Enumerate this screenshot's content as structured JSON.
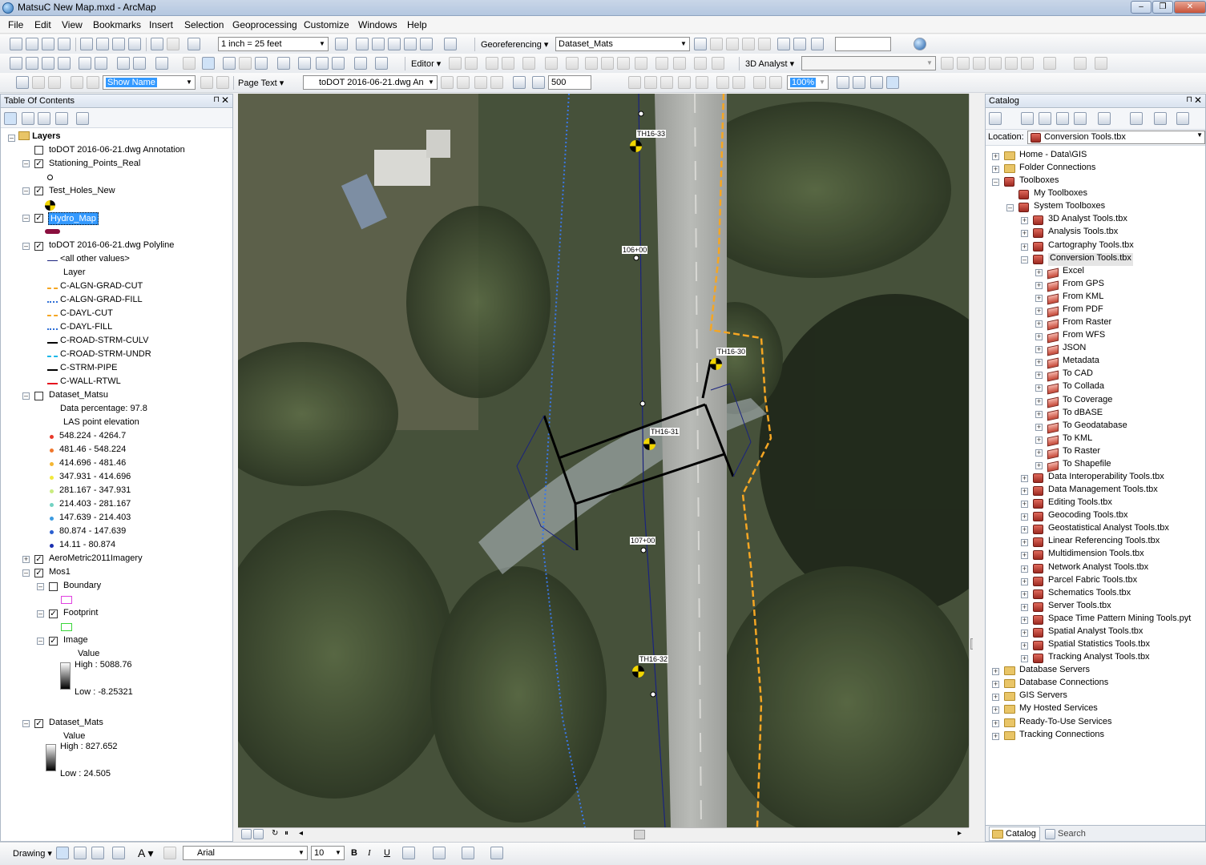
{
  "window": {
    "title": "MatsuC New Map.mxd - ArcMap",
    "controls": [
      "–",
      "❐",
      "✕"
    ]
  },
  "menu": [
    "File",
    "Edit",
    "View",
    "Bookmarks",
    "Insert",
    "Selection",
    "Geoprocessing",
    "Customize",
    "Windows",
    "Help"
  ],
  "toolbar1": {
    "scale": "1 inch = 25 feet",
    "georef_label": "Georeferencing ▾",
    "georef_layer": "Dataset_Mats",
    "empty_combo": ""
  },
  "toolbar2": {
    "editor_label": "Editor ▾",
    "analyst_label": "3D Analyst ▾",
    "analyst_combo": ""
  },
  "toolbar3": {
    "show_name": "Show Name",
    "page_text": "Page Text ▾",
    "annotation_layer": "toDOT 2016-06-21.dwg An",
    "reference_scale": "500",
    "zoom": "100%"
  },
  "toc": {
    "title": "Table Of Contents",
    "root": "Layers",
    "layers": {
      "annotation": "toDOT 2016-06-21.dwg Annotation",
      "stationing": "Stationing_Points_Real",
      "test_holes": "Test_Holes_New",
      "hydro": "Hydro_Map",
      "polyline": "toDOT 2016-06-21.dwg Polyline",
      "other_values": "<all other values>",
      "layer_field": "Layer",
      "classes": [
        {
          "label": "C-ALGN-GRAD-CUT",
          "color": "#f5a623",
          "style": "dashed"
        },
        {
          "label": "C-ALGN-GRAD-FILL",
          "color": "#2f6fd6",
          "style": "dotted"
        },
        {
          "label": "C-DAYL-CUT",
          "color": "#f5a623",
          "style": "dashed"
        },
        {
          "label": "C-DAYL-FILL",
          "color": "#2f6fd6",
          "style": "dotted"
        },
        {
          "label": "C-ROAD-STRM-CULV",
          "color": "#000000",
          "style": "solid"
        },
        {
          "label": "C-ROAD-STRM-UNDR",
          "color": "#1ab8e8",
          "style": "dashed"
        },
        {
          "label": "C-STRM-PIPE",
          "color": "#000000",
          "style": "solid"
        },
        {
          "label": "C-WALL-RTWL",
          "color": "#e5141e",
          "style": "solid"
        }
      ],
      "dataset_matsu": "Dataset_Matsu",
      "data_percentage": "Data percentage: 97.8",
      "las_label": "LAS point elevation",
      "las_ranges": [
        {
          "label": "548.224 - 4264.7",
          "color": "#e8392a"
        },
        {
          "label": "481.46 - 548.224",
          "color": "#f0772c"
        },
        {
          "label": "414.696 - 481.46",
          "color": "#f4b632"
        },
        {
          "label": "347.931 - 414.696",
          "color": "#f2e83d"
        },
        {
          "label": "281.167 - 347.931",
          "color": "#c9ec7f"
        },
        {
          "label": "214.403 - 281.167",
          "color": "#72d2c2"
        },
        {
          "label": "147.639 - 214.403",
          "color": "#3c9be0"
        },
        {
          "label": "80.874 - 147.639",
          "color": "#2a5fd0"
        },
        {
          "label": "14.11 - 80.874",
          "color": "#1a2fb0"
        }
      ],
      "aerometric": "AeroMetric2011Imagery",
      "mos1": "Mos1",
      "boundary": "Boundary",
      "footprint": "Footprint",
      "image": "Image",
      "value1": "Value",
      "high1": "High : 5088.76",
      "low1": "Low : -8.25321",
      "dataset_mats": "Dataset_Mats",
      "value2": "Value",
      "high2": "High : 827.652",
      "low2": "Low : 24.505"
    }
  },
  "map": {
    "labels": {
      "th33": "TH16-33",
      "th30": "TH16-30",
      "th31": "TH16-31",
      "th32": "TH16-32",
      "sta106": "106+00",
      "sta107": "107+00"
    }
  },
  "catalog": {
    "title": "Catalog",
    "location_label": "Location:",
    "location_value": "Conversion Tools.tbx",
    "items": {
      "home": "Home - Data\\GIS",
      "folder_connections": "Folder Connections",
      "toolboxes": "Toolboxes",
      "my_toolboxes": "My Toolboxes",
      "system_toolboxes": "System Toolboxes",
      "analyst3d": "3D Analyst Tools.tbx",
      "analysis": "Analysis Tools.tbx",
      "cartography": "Cartography Tools.tbx",
      "conversion": "Conversion Tools.tbx",
      "conversion_children": [
        "Excel",
        "From GPS",
        "From KML",
        "From PDF",
        "From Raster",
        "From WFS",
        "JSON",
        "Metadata",
        "To CAD",
        "To Collada",
        "To Coverage",
        "To dBASE",
        "To Geodatabase",
        "To KML",
        "To Raster",
        "To Shapefile"
      ],
      "more_toolboxes": [
        "Data Interoperability Tools.tbx",
        "Data Management Tools.tbx",
        "Editing Tools.tbx",
        "Geocoding Tools.tbx",
        "Geostatistical Analyst Tools.tbx",
        "Linear Referencing Tools.tbx",
        "Multidimension Tools.tbx",
        "Network Analyst Tools.tbx",
        "Parcel Fabric Tools.tbx",
        "Schematics Tools.tbx",
        "Server Tools.tbx",
        "Space Time Pattern Mining Tools.pyt",
        "Spatial Analyst Tools.tbx",
        "Spatial Statistics Tools.tbx",
        "Tracking Analyst Tools.tbx"
      ],
      "connections": [
        "Database Servers",
        "Database Connections",
        "GIS Servers",
        "My Hosted Services",
        "Ready-To-Use Services",
        "Tracking Connections"
      ]
    },
    "tabs": {
      "catalog": "Catalog",
      "search": "Search"
    }
  },
  "drawing": {
    "label": "Drawing ▾",
    "font": "Arial",
    "size": "10",
    "bold": "B",
    "italic": "I",
    "underline": "U",
    "text_tool": "A ▾"
  }
}
